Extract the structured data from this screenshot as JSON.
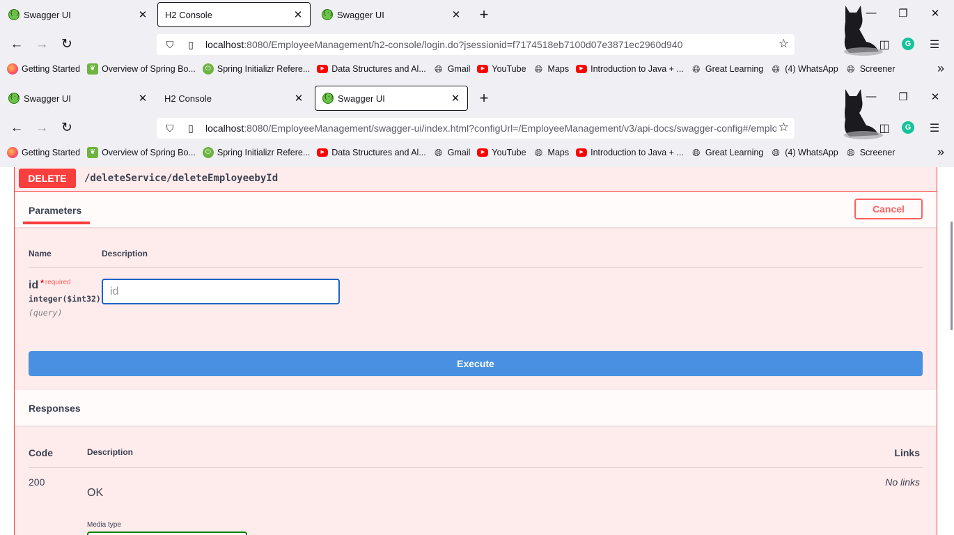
{
  "browser_top": {
    "tabs": [
      {
        "label": "Swagger UI",
        "icon": "swagger-favicon",
        "active": false
      },
      {
        "label": "H2 Console",
        "icon": "none",
        "active": true
      },
      {
        "label": "Swagger UI",
        "icon": "swagger-favicon",
        "active": false
      }
    ],
    "url_host": "localhost",
    "url_rest": ":8080/EmployeeManagement/h2-console/login.do?jsessionid=f7174518eb7100d07e3871ec2960d940"
  },
  "browser_bottom": {
    "tabs": [
      {
        "label": "Swagger UI",
        "icon": "swagger-favicon",
        "active": false
      },
      {
        "label": "H2 Console",
        "icon": "none",
        "active": false
      },
      {
        "label": "Swagger UI",
        "icon": "swagger-favicon",
        "active": true
      }
    ],
    "url_host": "localhost",
    "url_rest": ":8080/EmployeeManagement/swagger-ui/index.html?configUrl=/EmployeeManagement/v3/api-docs/swagger-config#/emplo"
  },
  "bookmarks": [
    {
      "label": "Getting Started",
      "icon": "firefox-icon"
    },
    {
      "label": "Overview of Spring Bo...",
      "icon": "spring-leaf-icon"
    },
    {
      "label": "Spring Initializr Refere...",
      "icon": "spring-power-icon"
    },
    {
      "label": "Data Structures and Al...",
      "icon": "youtube-icon"
    },
    {
      "label": "Gmail",
      "icon": "globe-icon"
    },
    {
      "label": "YouTube",
      "icon": "youtube-icon"
    },
    {
      "label": "Maps",
      "icon": "globe-icon"
    },
    {
      "label": "Introduction to Java + ...",
      "icon": "youtube-icon"
    },
    {
      "label": "Great Learning",
      "icon": "globe-icon"
    },
    {
      "label": "(4) WhatsApp",
      "icon": "globe-icon"
    },
    {
      "label": "Screener",
      "icon": "globe-icon"
    }
  ],
  "operation": {
    "method": "DELETE",
    "path": "/deleteService/deleteEmployeebyId",
    "parameters_tab": "Parameters",
    "cancel_label": "Cancel",
    "col_name": "Name",
    "col_description": "Description",
    "param": {
      "name": "id",
      "required_star": "*",
      "required_text": "required",
      "type": "integer($int32)",
      "in": "(query)",
      "placeholder": "id",
      "value": ""
    },
    "execute_label": "Execute",
    "responses_title": "Responses",
    "resp_col_code": "Code",
    "resp_col_description": "Description",
    "resp_col_links": "Links",
    "response": {
      "code": "200",
      "description": "OK",
      "links": "No links",
      "media_type_label": "Media type"
    }
  },
  "colors": {
    "delete_accent": "#f93e3e",
    "execute_blue": "#4990e2",
    "input_focus": "#1a63c8"
  }
}
